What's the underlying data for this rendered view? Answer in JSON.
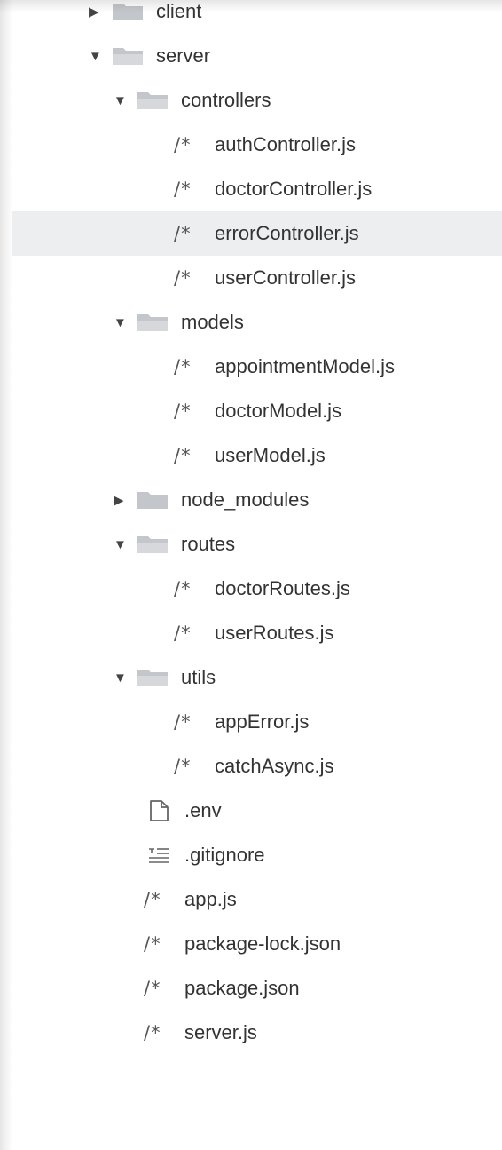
{
  "tree": [
    {
      "label": "client",
      "kind": "folder",
      "expanded": false,
      "depth": 0
    },
    {
      "label": "server",
      "kind": "folder",
      "expanded": true,
      "depth": 0
    },
    {
      "label": "controllers",
      "kind": "folder",
      "expanded": true,
      "depth": 1
    },
    {
      "label": "authController.js",
      "kind": "js",
      "depth": 2
    },
    {
      "label": "doctorController.js",
      "kind": "js",
      "depth": 2
    },
    {
      "label": "errorController.js",
      "kind": "js",
      "depth": 2,
      "selected": true
    },
    {
      "label": "userController.js",
      "kind": "js",
      "depth": 2
    },
    {
      "label": "models",
      "kind": "folder",
      "expanded": true,
      "depth": 1
    },
    {
      "label": "appointmentModel.js",
      "kind": "js",
      "depth": 2
    },
    {
      "label": "doctorModel.js",
      "kind": "js",
      "depth": 2
    },
    {
      "label": "userModel.js",
      "kind": "js",
      "depth": 2
    },
    {
      "label": "node_modules",
      "kind": "folder",
      "expanded": false,
      "depth": 1
    },
    {
      "label": "routes",
      "kind": "folder",
      "expanded": true,
      "depth": 1
    },
    {
      "label": "doctorRoutes.js",
      "kind": "js",
      "depth": 2
    },
    {
      "label": "userRoutes.js",
      "kind": "js",
      "depth": 2
    },
    {
      "label": "utils",
      "kind": "folder",
      "expanded": true,
      "depth": 1
    },
    {
      "label": "appError.js",
      "kind": "js",
      "depth": 2
    },
    {
      "label": "catchAsync.js",
      "kind": "js",
      "depth": 2
    },
    {
      "label": ".env",
      "kind": "file",
      "depth": 1
    },
    {
      "label": ".gitignore",
      "kind": "text",
      "depth": 1
    },
    {
      "label": "app.js",
      "kind": "js",
      "depth": 1
    },
    {
      "label": "package-lock.json",
      "kind": "js",
      "depth": 1
    },
    {
      "label": "package.json",
      "kind": "js",
      "depth": 1
    },
    {
      "label": "server.js",
      "kind": "js",
      "depth": 1
    }
  ],
  "icons": {
    "js": "/*",
    "caret_open": "▼",
    "caret_closed": "▶"
  },
  "colors": {
    "selected_row": "#eceef0",
    "folder": "#c3c6ca"
  }
}
